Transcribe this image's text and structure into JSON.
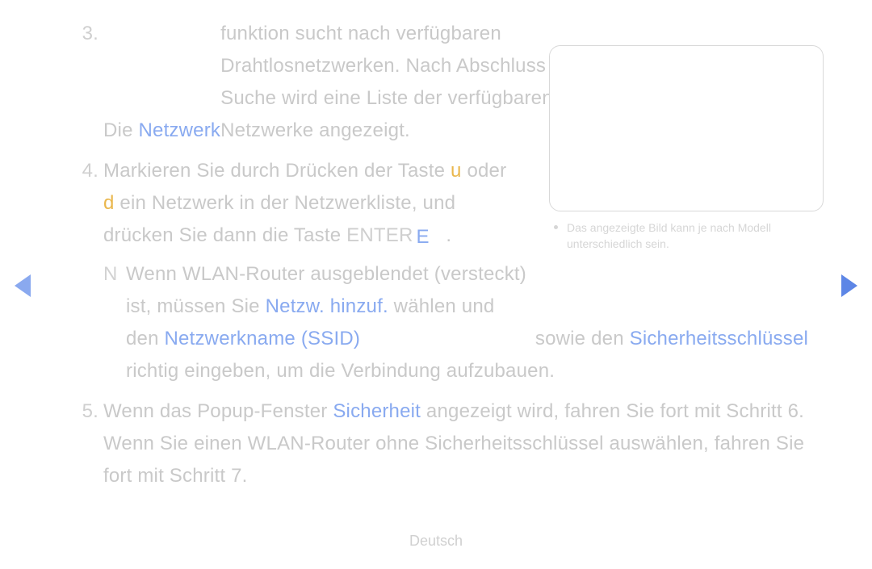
{
  "items": {
    "i3": {
      "num": "3.",
      "pre": "Die ",
      "netzwerk": "Netzwerk",
      "rest": " funktion sucht nach verfügbaren Drahtlosnetzwerken. Nach Abschluss der Suche wird eine Liste der verfügbaren Netzwerke angezeigt."
    },
    "i4": {
      "num": "4.",
      "a": "Markieren Sie durch Drücken der Taste ",
      "u": "u",
      "b": " oder ",
      "d": "d",
      "c": " ein Netzwerk in der Netzwerkliste, und drücken Sie dann die Taste ",
      "enter": "ENTER",
      "eicon": "E",
      "dot": "."
    },
    "note": {
      "n": "N",
      "a": "Wenn WLAN-Router ausgeblendet (versteckt) ist, müssen Sie ",
      "netzw": "Netzw. hinzuf.",
      "b": " wählen und den ",
      "name": "Netzwerkname (SSID)",
      "c": " sowie den ",
      "key": "Sicherheitsschlüssel",
      "d": " richtig eingeben, um die Verbindung aufzubauen."
    },
    "i5": {
      "num": "5.",
      "a": "Wenn das Popup-Fenster ",
      "sich": "Sicherheit",
      "b": " angezeigt wird, fahren Sie fort mit Schritt 6. Wenn Sie einen WLAN-Router ohne Sicherheitsschlüssel auswählen, fahren Sie fort mit Schritt 7."
    }
  },
  "figure": {
    "caption": "Das angezeigte Bild kann je nach Modell unterschiedlich sein."
  },
  "footer": "Deutsch"
}
